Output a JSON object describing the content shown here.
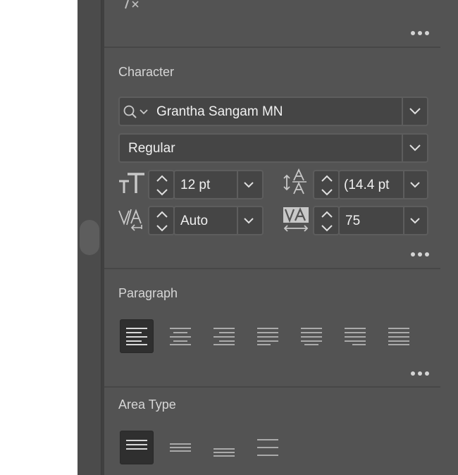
{
  "character": {
    "title": "Character",
    "font_family": "Grantha Sangam MN",
    "font_style": "Regular",
    "font_size": "12 pt",
    "leading": "(14.4 pt",
    "kerning": "Auto",
    "tracking": "75"
  },
  "paragraph": {
    "title": "Paragraph",
    "alignments": [
      "align-left",
      "align-center",
      "align-right",
      "justify-last-left",
      "justify-last-center",
      "justify-last-right",
      "justify-all"
    ],
    "active": "align-left"
  },
  "area_type": {
    "title": "Area Type",
    "alignments": [
      "align-top",
      "align-center",
      "align-bottom",
      "align-justify"
    ],
    "active": "align-top"
  },
  "colors": {
    "panel_bg": "#535353",
    "field_bg": "#454545",
    "text": "#f0f0f0",
    "label": "#d6d6d6",
    "active_button": "#2f2f2f"
  }
}
